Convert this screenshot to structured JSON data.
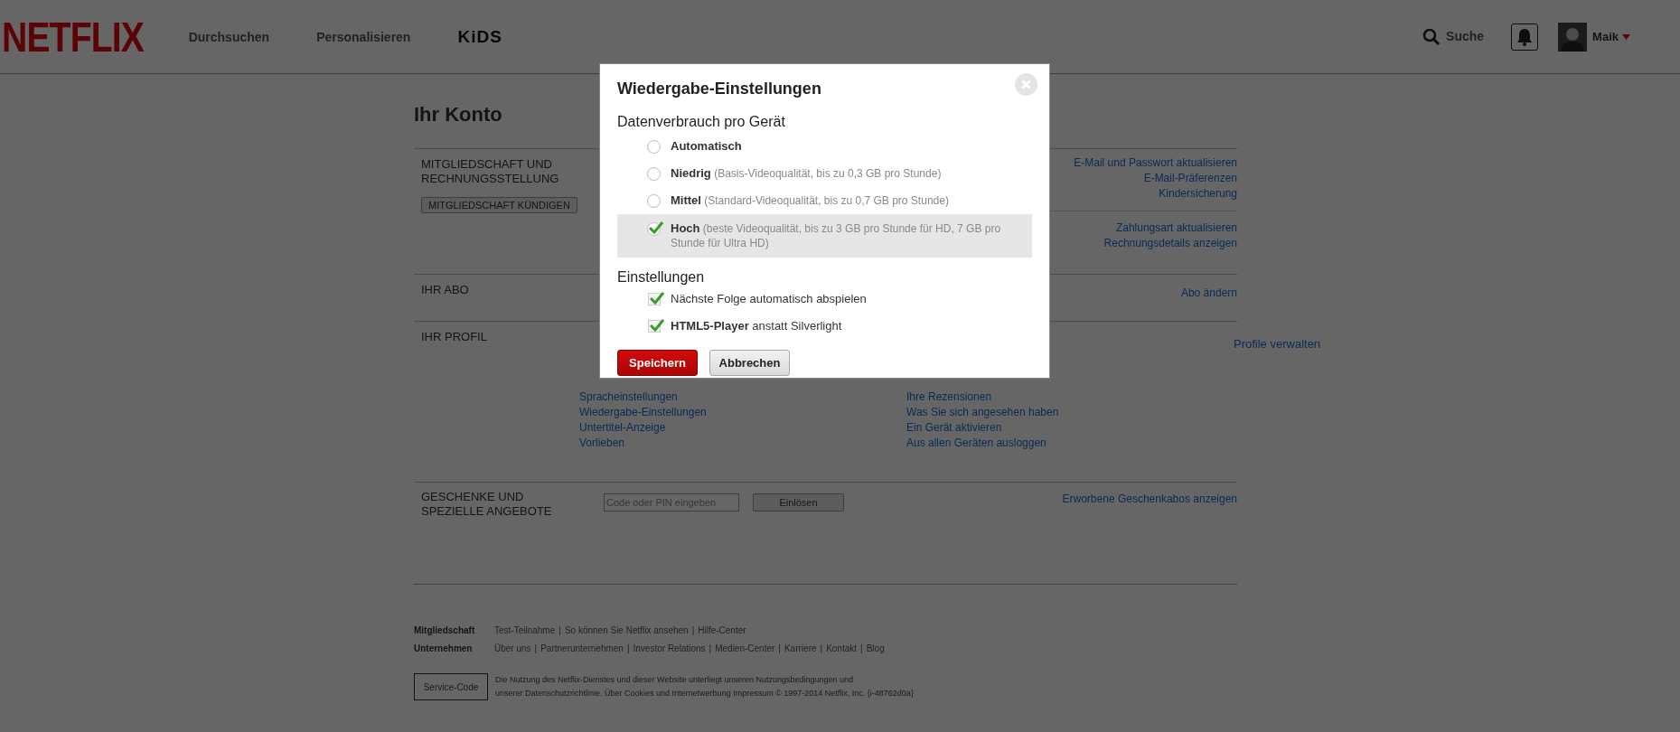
{
  "header": {
    "logo": "NETFLIX",
    "nav": [
      {
        "label": "Durchsuchen",
        "kind": "text"
      },
      {
        "label": "Personalisieren",
        "kind": "text"
      },
      {
        "label": "KiDS",
        "kind": "logo"
      }
    ],
    "search": "Suche",
    "user": "Maik"
  },
  "account": {
    "title": "Ihr Konto",
    "sections": [
      {
        "kind": "membership",
        "title": "MITGLIEDSCHAFT UND RECHNUNGSSTELLUNG",
        "button": "MITGLIEDSCHAFT KÜNDIGEN",
        "link_groups": [
          [
            "E-Mail und Passwort aktualisieren",
            "E-Mail-Präferenzen",
            "Kindersicherung"
          ],
          [
            "Zahlungsart aktualisieren",
            "Rechnungsdetails anzeigen"
          ]
        ]
      },
      {
        "kind": "plan",
        "title": "IHR ABO",
        "links": [
          "Abo ändern"
        ]
      },
      {
        "kind": "profile",
        "title": "IHR PROFIL",
        "links": [
          "Profile verwalten"
        ],
        "columns": [
          [
            "Spracheinstellungen",
            "Wiedergabe-Einstellungen",
            "Untertitel-Anzeige",
            "Vorlieben"
          ],
          [
            "Ihre Rezensionen",
            "Was Sie sich angesehen haben",
            "Ein Gerät aktivieren",
            "Aus allen Geräten ausloggen"
          ]
        ]
      },
      {
        "kind": "gifts",
        "title": "GESCHENKE UND SPEZIELLE ANGEBOTE",
        "placeholder": "Code oder PIN eingeben",
        "button": "Einlösen",
        "links": [
          "Erworbene Geschenkabos anzeigen"
        ]
      }
    ]
  },
  "footer": {
    "rows": [
      {
        "label": "Mitgliedschaft",
        "links": [
          "Test-Teilnahme",
          "So können Sie Netflix ansehen",
          "Hilfe-Center"
        ]
      },
      {
        "label": "Unternehmen",
        "links": [
          "Über uns",
          "Partnerunternehmen",
          "Investor Relations",
          "Medien-Center",
          "Karriere",
          "Kontakt",
          "Blog"
        ]
      }
    ],
    "separator": "|",
    "service_code": "Service-Code",
    "legal": [
      "Die Nutzung des Netflix-Dienstes und dieser Website unterliegt unseren Nutzungsbedingungen und",
      "unserer Datenschutzrichtlinie. Über Cookies und Internetwerbung Impressum © 1997-2014 Netflix, Inc. {i-48762d0a}"
    ]
  },
  "dialog": {
    "title": "Wiedergabe-Einstellungen",
    "data_heading": "Datenverbrauch pro Gerät",
    "options": [
      {
        "name": "Automatisch",
        "selected": false
      },
      {
        "name": "Niedrig",
        "detail": "(Basis-Videoqualität, bis zu 0,3 GB pro Stunde)",
        "selected": false
      },
      {
        "name": "Mittel",
        "detail": "(Standard-Videoqualität, bis zu 0,7 GB pro Stunde)",
        "selected": false
      },
      {
        "name": "Hoch",
        "detail": "(beste Videoqualität, bis zu 3 GB pro Stunde für HD, 7 GB pro Stunde für Ultra HD)",
        "selected": true
      }
    ],
    "settings_heading": "Einstellungen",
    "settings": [
      {
        "label": "Nächste Folge automatisch abspielen",
        "checked": true
      },
      {
        "label": "**HTML5-Player** anstatt Silverlight",
        "checked": true
      }
    ],
    "save": "Speichern",
    "cancel": "Abbrechen"
  }
}
